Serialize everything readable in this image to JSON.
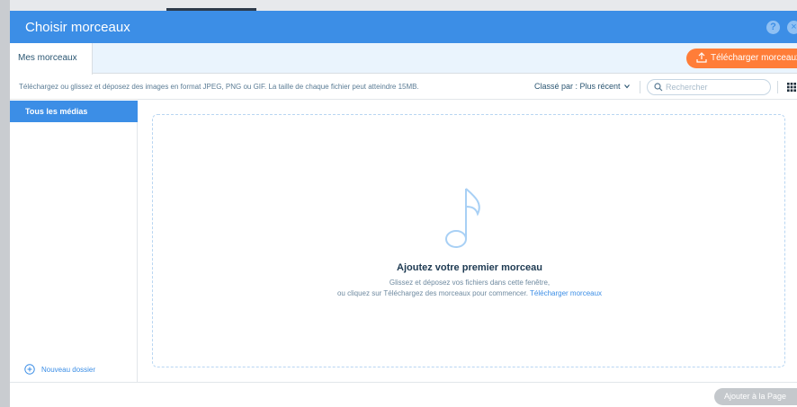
{
  "header": {
    "title": "Choisir morceaux",
    "help_label": "?",
    "close_label": "×"
  },
  "tabs": {
    "active_label": "Mes morceaux"
  },
  "upload_button": {
    "label": "Télécharger morceaux",
    "icon": "upload-icon"
  },
  "infobar": {
    "text": "Téléchargez ou glissez et déposez des images en format JPEG, PNG ou GIF. La taille de chaque fichier peut atteindre 15MB.",
    "sort_label": "Classé par : Plus récent",
    "search_placeholder": "Rechercher"
  },
  "sidebar": {
    "items": [
      {
        "label": "Tous les médias"
      }
    ],
    "new_folder_label": "Nouveau dossier"
  },
  "dropzone": {
    "icon": "music-note-icon",
    "title": "Ajoutez votre premier morceau",
    "line1": "Glissez et déposez vos fichiers dans cette fenêtre,",
    "line2_prefix": "ou cliquez sur Téléchargez des morceaux pour commencer.",
    "line2_link": "Télécharger morceaux"
  },
  "footer": {
    "add_label": "Ajouter à la Page"
  },
  "colors": {
    "primary": "#3c8ee6",
    "accent": "#ff7d38",
    "disabled": "#c4c8cc"
  }
}
